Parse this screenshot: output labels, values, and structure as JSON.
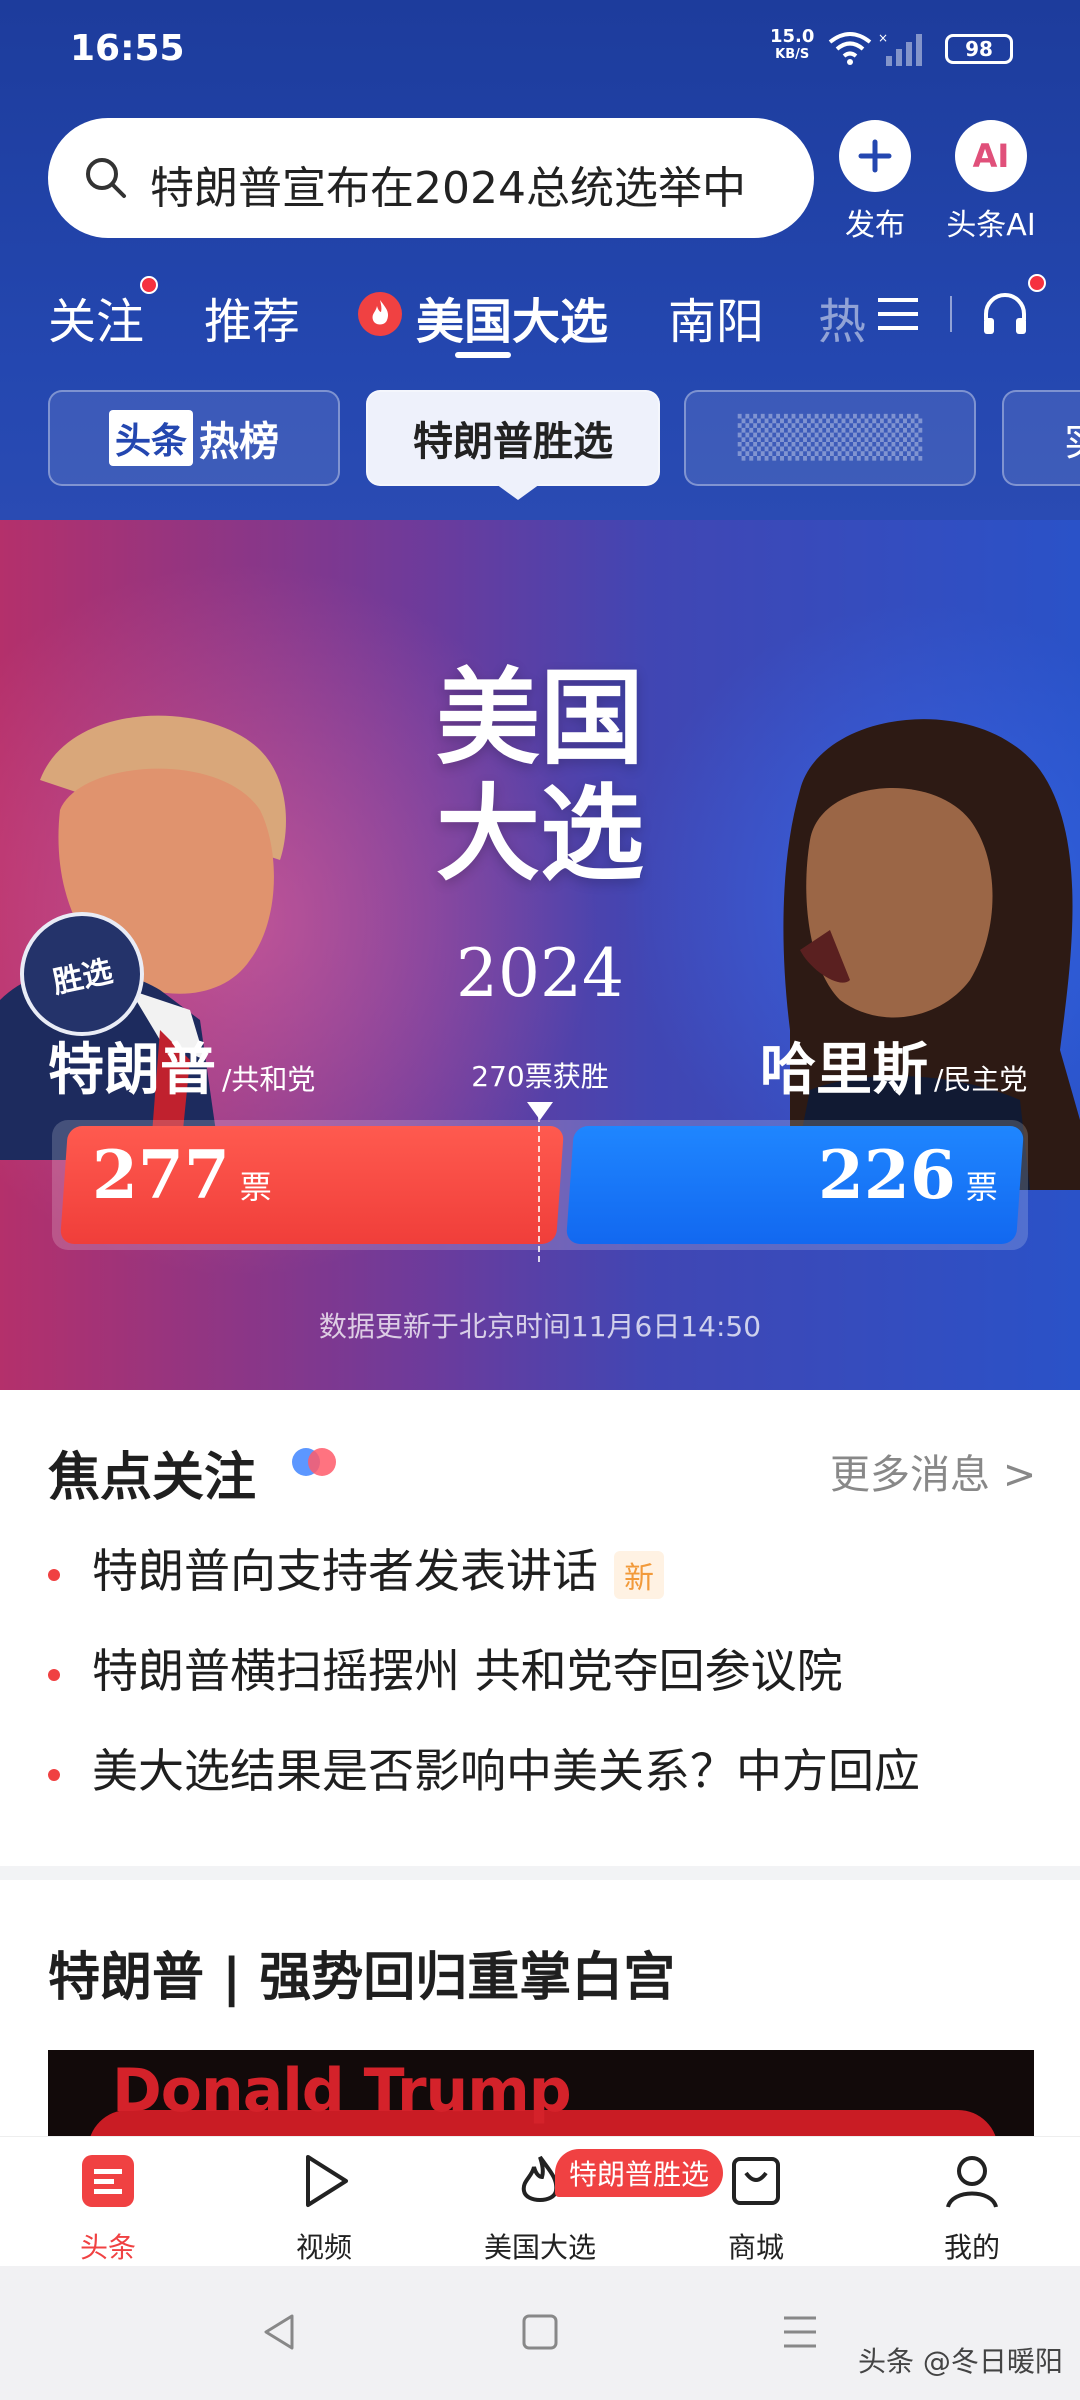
{
  "status_bar": {
    "time": "16:55",
    "net_speed": "15.0",
    "net_unit": "KB/S",
    "battery": "98"
  },
  "search": {
    "query": "特朗普宣布在2024总统选举中"
  },
  "header_buttons": {
    "publish": "发布",
    "ai_label": "头条AI",
    "ai_icon_text": "AI"
  },
  "tabs": [
    "关注",
    "推荐",
    "美国大选",
    "南阳",
    "热"
  ],
  "chips": {
    "hot_brand": "头条",
    "hot_suffix": "热榜",
    "selected": "特朗普胜选",
    "blurred": "▒▒▒▒▒▒",
    "partial": "实"
  },
  "banner": {
    "title_line1": "美国",
    "title_line2": "大选",
    "year": "2024",
    "badge": "胜选",
    "left_name": "特朗普",
    "left_party": "/共和党",
    "right_name": "哈里斯",
    "right_party": "/民主党",
    "threshold": "270票获胜",
    "left_votes": "277",
    "right_votes": "226",
    "vote_unit": "票",
    "update_text": "数据更新于北京时间11月6日14:50",
    "colors": {
      "republican": "#f03e3a",
      "democrat": "#1268f0"
    }
  },
  "focus": {
    "title": "焦点关注",
    "more": "更多消息 >",
    "items": [
      {
        "text": "特朗普向支持者发表讲话",
        "tag": "新"
      },
      {
        "text": "特朗普横扫摇摆州 共和党夺回参议院",
        "tag": ""
      },
      {
        "text": "美大选结果是否影响中美关系？中方回应",
        "tag": ""
      }
    ]
  },
  "section": {
    "title": "特朗普 | 强势回归重掌白宫",
    "video_text": "Donald Trump"
  },
  "bottom_nav": {
    "items": [
      "头条",
      "视频",
      "美国大选",
      "商城",
      "我的"
    ],
    "badge": "特朗普胜选",
    "active_color": "#f04142"
  },
  "watermark": "头条 @冬日暖阳"
}
